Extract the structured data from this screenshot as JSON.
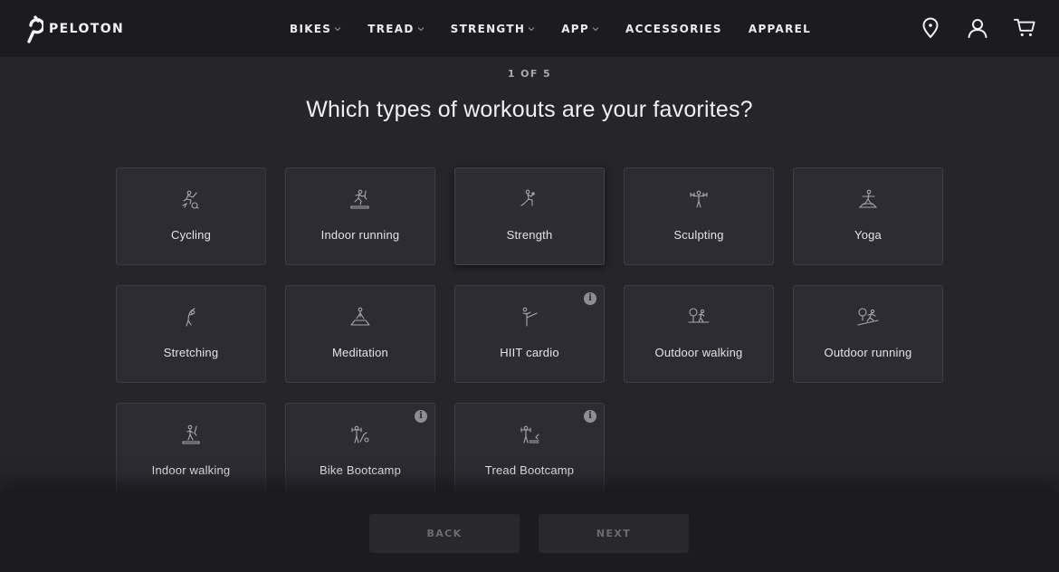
{
  "header": {
    "brand": "PELOTON",
    "nav": [
      {
        "label": "BIKES",
        "has_dropdown": true
      },
      {
        "label": "TREAD",
        "has_dropdown": true
      },
      {
        "label": "STRENGTH",
        "has_dropdown": true
      },
      {
        "label": "APP",
        "has_dropdown": true
      },
      {
        "label": "ACCESSORIES",
        "has_dropdown": false
      },
      {
        "label": "APPAREL",
        "has_dropdown": false
      }
    ],
    "icons": [
      "location-pin-icon",
      "account-icon",
      "cart-icon"
    ]
  },
  "quiz": {
    "step": "1 OF 5",
    "question": "Which types of workouts are your favorites?",
    "options": [
      {
        "label": "Cycling",
        "icon": "cycling-icon",
        "info": false
      },
      {
        "label": "Indoor running",
        "icon": "treadmill-running-icon",
        "info": false
      },
      {
        "label": "Strength",
        "icon": "strength-icon",
        "info": false,
        "hovered": true
      },
      {
        "label": "Sculpting",
        "icon": "dumbbells-icon",
        "info": false
      },
      {
        "label": "Yoga",
        "icon": "yoga-icon",
        "info": false
      },
      {
        "label": "Stretching",
        "icon": "stretching-icon",
        "info": false
      },
      {
        "label": "Meditation",
        "icon": "meditation-icon",
        "info": false
      },
      {
        "label": "HIIT cardio",
        "icon": "hiit-kick-icon",
        "info": true
      },
      {
        "label": "Outdoor walking",
        "icon": "outdoor-walking-icon",
        "info": false
      },
      {
        "label": "Outdoor running",
        "icon": "outdoor-running-icon",
        "info": false
      },
      {
        "label": "Indoor walking",
        "icon": "treadmill-walking-icon",
        "info": false
      },
      {
        "label": "Bike Bootcamp",
        "icon": "bike-bootcamp-icon",
        "info": true
      },
      {
        "label": "Tread Bootcamp",
        "icon": "tread-bootcamp-icon",
        "info": true
      }
    ],
    "info_glyph": "i"
  },
  "footer": {
    "back_label": "BACK",
    "next_label": "NEXT"
  },
  "colors": {
    "background": "#25252a",
    "header_bg": "#1b1b20",
    "card_bg": "#2c2c32",
    "card_border": "#3c3c42",
    "button_text_disabled": "#6b6b70"
  }
}
